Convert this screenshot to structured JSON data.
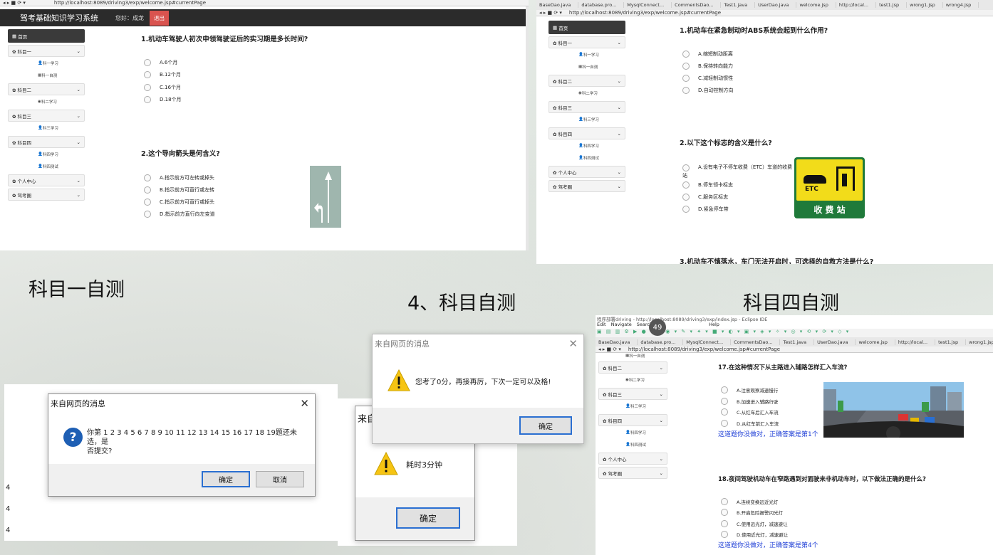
{
  "url_top_left": "http://localhost:8089/driving3/exp/welcome.jsp#currentPage",
  "url_top_right": "http://localhost:8089/driving3/exp/welcome.jsp#currentPage",
  "url_bottom_right": "http://localhost:8089/driving3/exp/welcome.jsp#currentPage",
  "eclipse_title": "程序部署driving - http://localhost:8089/driving3/exp/index.jsp - Eclipse IDE",
  "eclipse_menu": [
    "Edit",
    "Navigate",
    "Search",
    "Help"
  ],
  "zoom_badge": "49",
  "tabs": [
    "BaseDao.java",
    "database.pro...",
    "MysqlConnect...",
    "CommentsDao...",
    "Test1.java",
    "UserDao.java",
    "welcome.jsp",
    "http://local...",
    "test1.jsp",
    "wrong1.jsp",
    "wrong4.jsp"
  ],
  "app": {
    "title": "驾考基础知识学习系统",
    "hello": "您好：成龙",
    "logout": "退出"
  },
  "sidebar_left": {
    "home": "首页",
    "groups": [
      {
        "label": "科目一",
        "subs": [
          "科一学习",
          "科一自测"
        ]
      },
      {
        "label": "科目二",
        "subs": [
          "科二学习"
        ]
      },
      {
        "label": "科目三",
        "subs": [
          "科三学习"
        ]
      },
      {
        "label": "科目四",
        "subs": [
          "科四学习",
          "科四测试"
        ]
      },
      {
        "label": "个人中心",
        "subs": []
      },
      {
        "label": "驾考圈",
        "subs": []
      }
    ]
  },
  "panel1": {
    "q1": "1.机动车驾驶人初次申领驾驶证后的实习期是多长时间?",
    "q1_opts": [
      "A.6个月",
      "B.12个月",
      "C.16个月",
      "D.18个月"
    ],
    "q2": "2.这个导向箭头是何含义?",
    "q2_opts": [
      "A.指示前方可左转或掉头",
      "B.指示前方可直行或左转",
      "C.指示前方可直行或掉头",
      "D.指示前方直行向左变道"
    ]
  },
  "panel2": {
    "q1": "1.机动车在紧急制动时ABS系统会起到什么作用?",
    "q1_opts": [
      "A.缩短制动距离",
      "B.保持转向能力",
      "C.减轻制动惯性",
      "D.自动控制方向"
    ],
    "q2": "2.以下这个标志的含义是什么?",
    "q2_opts": [
      "A.设有电子不停车收费（ETC）车道的收费站",
      "B.停车领卡标志",
      "C.服务区标志",
      "D.紧急停车带"
    ],
    "q3": "3.机动车不慎落水，车门无法开启时，可选择的自救方法是什么?",
    "etc_text": "ETC",
    "etc_sign": "收 费 站"
  },
  "panel3": {
    "q17": "17.在这种情况下从主路进入辅路怎样汇入车流?",
    "q17_opts": [
      "A.注意观察减速慢行",
      "B.加速进入辅路行驶",
      "C.从红车后汇入车流",
      "D.从红车前汇入车流"
    ],
    "q17_hint": "这道题你没做对，正确答案是第1个",
    "q18": "18.夜间驾驶机动车在窄路遇到对面驶来非机动车时，以下做法正确的是什么?",
    "q18_opts": [
      "A.连续变换远近光灯",
      "B.开启危险报警闪光灯",
      "C.使用远光灯，减速避让",
      "D.使用近光灯，减速避让"
    ],
    "q18_hint": "这道题你没做对，正确答案是第4个",
    "sidebar": {
      "top_sub": "科一自测",
      "groups": [
        {
          "label": "科目二",
          "subs": [
            "科二学习"
          ]
        },
        {
          "label": "科目三",
          "subs": [
            "科三学习"
          ]
        },
        {
          "label": "科目四",
          "subs": [
            "科四学习",
            "科四测试"
          ]
        },
        {
          "label": "个人中心",
          "subs": []
        },
        {
          "label": "驾考圈",
          "subs": []
        }
      ]
    }
  },
  "captions": {
    "c1": "科目一自测",
    "c2": "4、科目自测",
    "c3": "科目四自测"
  },
  "dialog_confirm": {
    "title": "来自网页的消息",
    "line1": "你第 1 2 3 4 5 6 7 8 9 10 11 12 13 14 15 16 17 18 19题还未选，是",
    "line2": "否提交?",
    "ok": "确定",
    "cancel": "取消"
  },
  "dialog_time": {
    "title": "来自网页的消息",
    "message": "耗时3分钟",
    "ok": "确定"
  },
  "dialog_score": {
    "title": "来自网页的消息",
    "message": "您考了0分，再接再厉，下次一定可以及格!",
    "ok": "确定"
  },
  "stray_digits": [
    "4",
    "4",
    "4"
  ],
  "colors": {
    "accent_blue": "#2a6fd1",
    "hint_blue": "#1f3fd6",
    "logout_red": "#d9534f",
    "sign_green": "#1f7a3a",
    "sign_yellow": "#f2dc1a"
  }
}
